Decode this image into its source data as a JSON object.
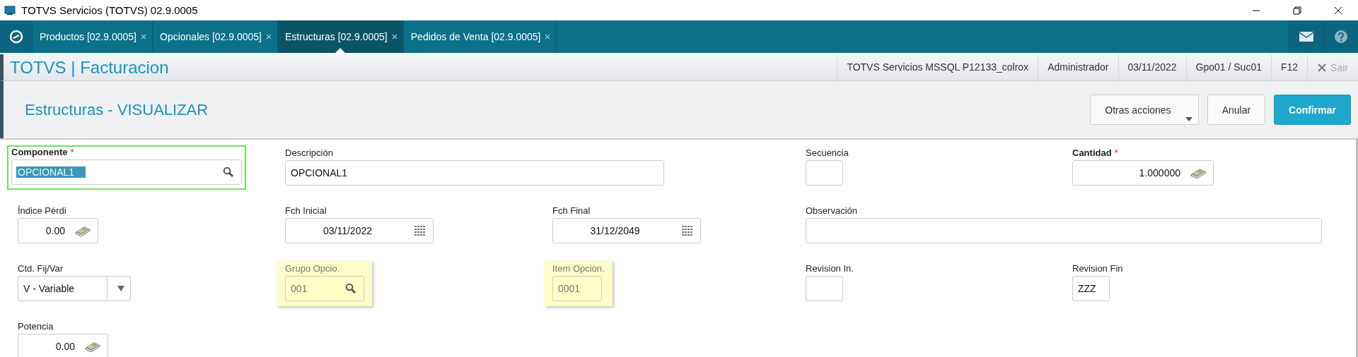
{
  "window": {
    "title": "TOTVS Servicios (TOTVS) 02.9.0005"
  },
  "tabs": [
    {
      "label": "Productos [02.9.0005]",
      "selected": false
    },
    {
      "label": "Opcionales [02.9.0005]",
      "selected": false
    },
    {
      "label": "Estructuras [02.9.0005]",
      "selected": true
    },
    {
      "label": "Pedidos de Venta [02.9.0005]",
      "selected": false
    }
  ],
  "app": {
    "brand": "TOTVS | Facturacion",
    "info": [
      "TOTVS Servicios MSSQL P12133_colrox",
      "Administrador",
      "03/11/2022",
      "Gpo01 / Suc01",
      "F12"
    ],
    "exit": {
      "label": "Sair",
      "disabled": true
    }
  },
  "page": {
    "title": "Estructuras - VISUALIZAR",
    "buttons": [
      {
        "label": "Otras acciones",
        "kind": "menu"
      },
      {
        "label": "Anular",
        "kind": "plain"
      },
      {
        "label": "Confirmar",
        "kind": "primary"
      }
    ]
  },
  "fields": [
    {
      "label": "Componente",
      "required_mark": "*",
      "kind": "lookup",
      "value": "OPCIONAL1",
      "focused": true,
      "text_selected": true,
      "highlighted": false
    },
    {
      "label": "Descripción",
      "kind": "text",
      "value": "OPCIONAL1",
      "focused": false,
      "highlighted": false
    },
    {
      "label": "Secuencia",
      "kind": "text",
      "focused": false,
      "highlighted": false
    },
    {
      "label": "Cantidad",
      "required_mark": "*",
      "kind": "number",
      "value": "1.000000",
      "focused": false,
      "highlighted": false
    },
    {
      "label": "Índice Pérdi",
      "kind": "number",
      "value": "0.00",
      "focused": false,
      "highlighted": false
    },
    {
      "label": "Fch Inicial",
      "kind": "date",
      "value": "03/11/2022",
      "focused": false,
      "highlighted": false
    },
    {
      "label": "Fch Final",
      "kind": "date",
      "value": "31/12/2049",
      "focused": false,
      "highlighted": false
    },
    {
      "label": "Observación",
      "kind": "text",
      "focused": false,
      "highlighted": false
    },
    {
      "label": "Ctd. Fij/Var",
      "kind": "select",
      "value": "V - Variable",
      "focused": false,
      "highlighted": false
    },
    {
      "label": "Grupo Opcio.",
      "kind": "lookup",
      "value": "001",
      "focused": false,
      "highlighted": true
    },
    {
      "label": "Item Opcion.",
      "kind": "text",
      "value": "0001",
      "focused": false,
      "highlighted": true
    },
    {
      "label": "Revision In.",
      "kind": "text",
      "focused": false,
      "highlighted": false
    },
    {
      "label": "Revision Fin",
      "kind": "text",
      "value": "ZZZ",
      "focused": false,
      "highlighted": false
    },
    {
      "label": "Potencia",
      "kind": "number",
      "value": "0.00",
      "focused": false,
      "highlighted": false
    }
  ]
}
